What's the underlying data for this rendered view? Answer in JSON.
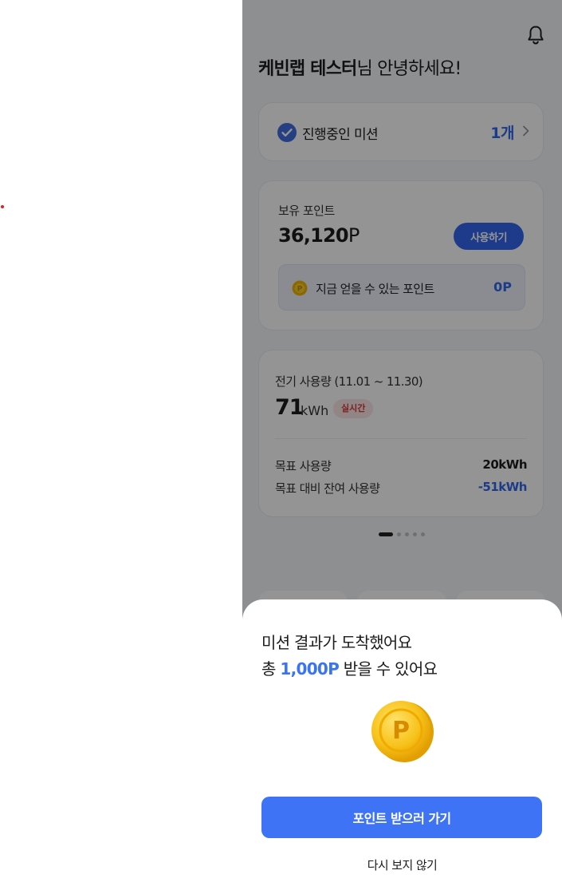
{
  "header": {
    "user_name": "케빈랩 테스터",
    "greeting_suffix": "님 안녕하세요!",
    "bell_icon": "bell-icon"
  },
  "mission": {
    "label": "진행중인 미션",
    "count": "1개",
    "icon": "check-circle-icon"
  },
  "points": {
    "title": "보유 포인트",
    "amount": "36,120",
    "unit": "P",
    "use_button": "사용하기",
    "earnable_label": "지금 얻을 수 있는 포인트",
    "earnable_value": "0P"
  },
  "usage": {
    "title": "전기 사용량 (11.01 ~ 11.30)",
    "value": "71",
    "unit": "kWh",
    "realtime_badge": "실시간",
    "goal_label": "목표 사용량",
    "goal_value": "20kWh",
    "remaining_label": "목표 대비 잔여 사용량",
    "remaining_value": "-51kWh"
  },
  "pager": {
    "count": 5,
    "active_index": 0
  },
  "sheet": {
    "line1": "미션 결과가 도착했어요",
    "line2_prefix": "총 ",
    "line2_highlight": "1,000P",
    "line2_suffix": " 받을 수 있어요",
    "cta_button": "포인트 받으러 가기",
    "dismiss_link": "다시 보지 않기"
  },
  "colors": {
    "accent": "#3d73f4",
    "highlight_text": "#3167ed",
    "badge_text": "#d13a3a",
    "coin": "#f5c518"
  }
}
